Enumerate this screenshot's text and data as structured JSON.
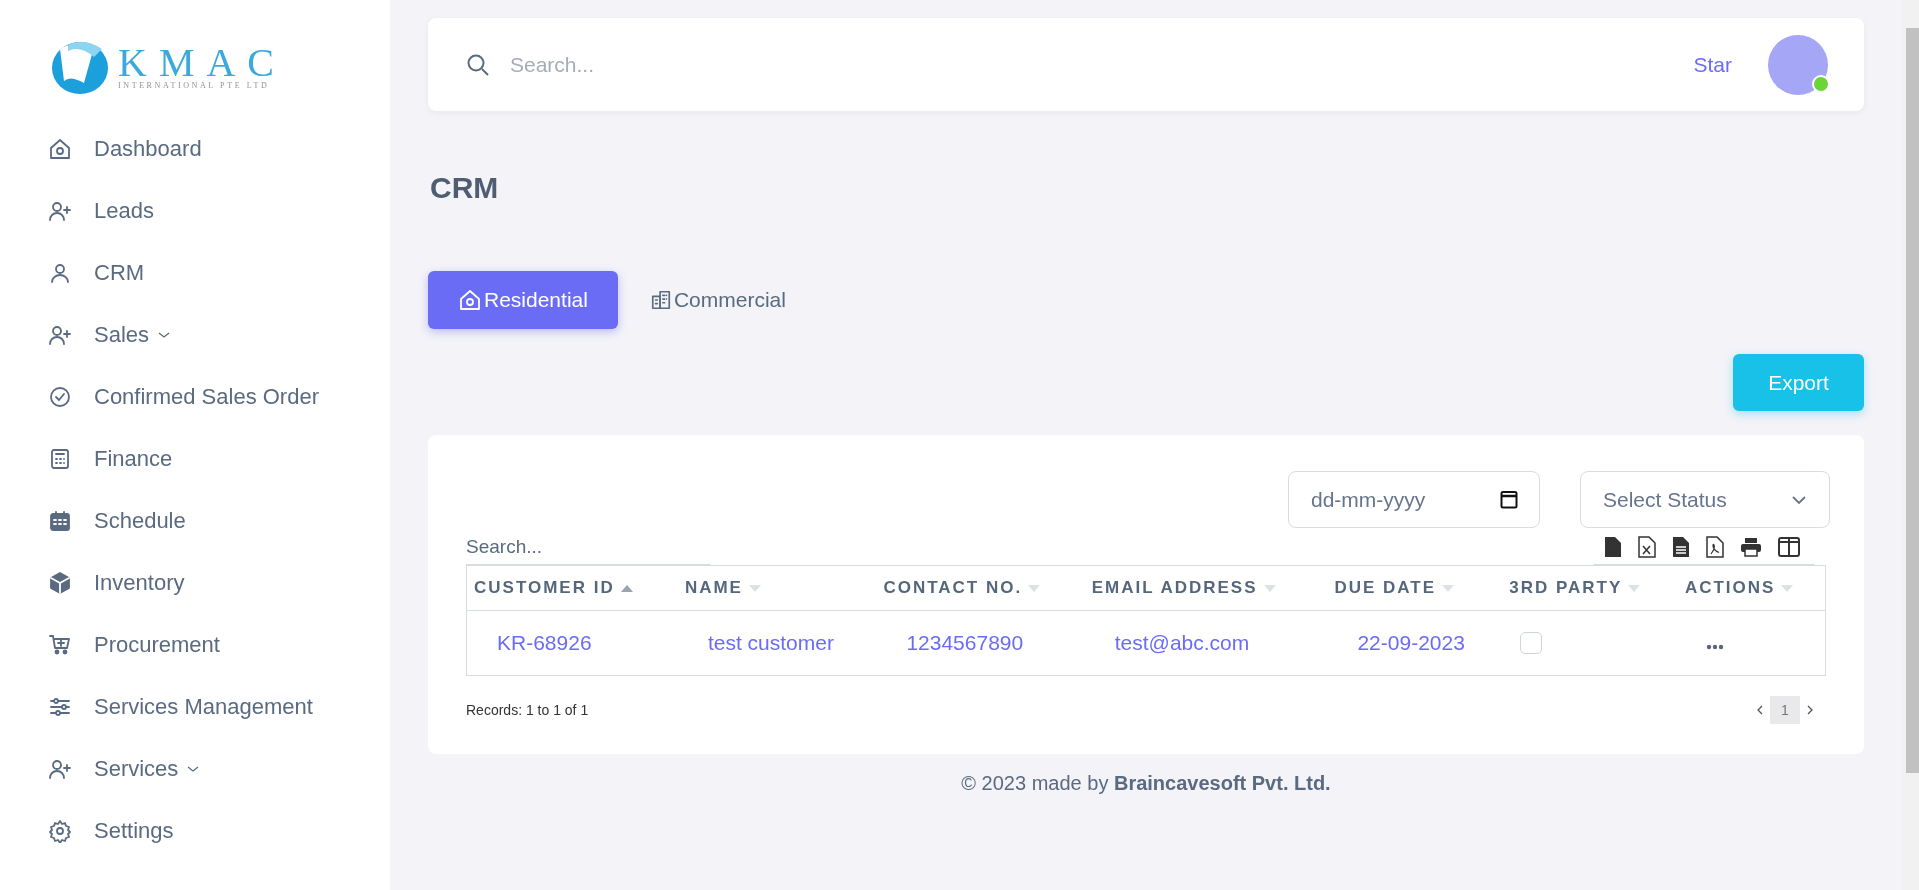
{
  "logo": {
    "name": "KMAC",
    "subtitle": "INTERNATIONAL PTE LTD"
  },
  "sidebar": {
    "items": [
      {
        "label": "Dashboard",
        "expandable": false
      },
      {
        "label": "Leads",
        "expandable": false
      },
      {
        "label": "CRM",
        "expandable": false
      },
      {
        "label": "Sales",
        "expandable": true
      },
      {
        "label": "Confirmed Sales Order",
        "expandable": false
      },
      {
        "label": "Finance",
        "expandable": false
      },
      {
        "label": "Schedule",
        "expandable": false
      },
      {
        "label": "Inventory",
        "expandable": false
      },
      {
        "label": "Procurement",
        "expandable": false
      },
      {
        "label": "Services Management",
        "expandable": false
      },
      {
        "label": "Services",
        "expandable": true
      },
      {
        "label": "Settings",
        "expandable": false
      }
    ]
  },
  "topbar": {
    "search": {
      "placeholder": "Search..."
    },
    "user_name": "Star",
    "user_online": true
  },
  "page_title": "CRM",
  "tabs": [
    {
      "label": "Residential",
      "selected": true
    },
    {
      "label": "Commercial",
      "selected": false
    }
  ],
  "export_button": "Export",
  "table": {
    "search": {
      "placeholder": "Search..."
    },
    "date_filter": {
      "placeholder": "dd-mm-yyyy"
    },
    "status_filter": {
      "placeholder": "Select Status"
    },
    "columns": [
      {
        "label": "CUSTOMER ID",
        "sorted": true
      },
      {
        "label": "NAME",
        "sorted": false
      },
      {
        "label": "CONTACT NO.",
        "sorted": false
      },
      {
        "label": "EMAIL ADDRESS",
        "sorted": false
      },
      {
        "label": "DUE DATE",
        "sorted": false
      },
      {
        "label": "3RD PARTY",
        "sorted": false
      },
      {
        "label": "ACTIONS",
        "sorted": false
      }
    ],
    "rows": [
      {
        "customer_id": "KR-68926",
        "name": "test customer",
        "contact_no": "1234567890",
        "email": "test@abc.com",
        "due_date": "22-09-2023",
        "third_party": false
      }
    ],
    "records": "Records: 1 to 1 of 1",
    "pages": [
      {
        "label": "1",
        "selected": true
      }
    ]
  },
  "footer": "© 2023 made by **Braincavesoft Pvt. Ltd.**"
}
